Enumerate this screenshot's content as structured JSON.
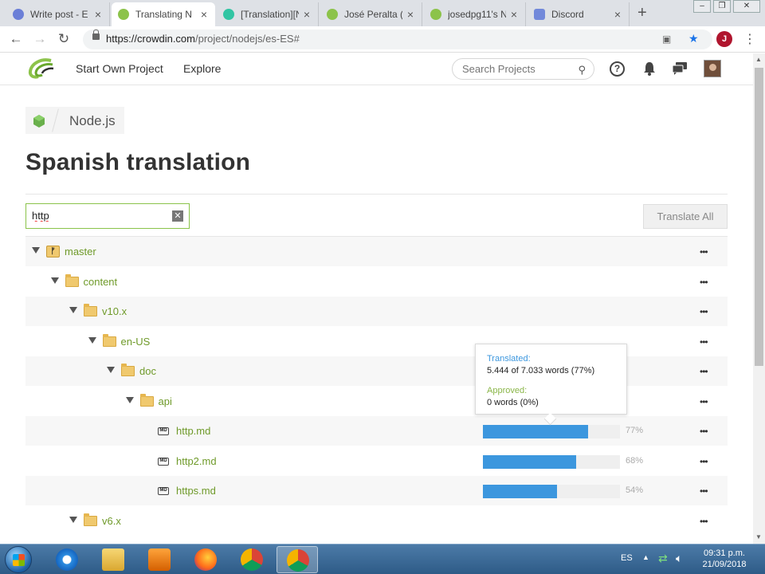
{
  "browser": {
    "tabs": [
      {
        "title": "Write post - E",
        "favicon_color": "#6b7fd7"
      },
      {
        "title": "Translating N",
        "favicon_color": "#8cc34a",
        "active": true
      },
      {
        "title": "[Translation][N",
        "favicon_color": "#31c5a3"
      },
      {
        "title": "José Peralta (",
        "favicon_color": "#8cc34a"
      },
      {
        "title": "josedpg11's N",
        "favicon_color": "#8cc34a"
      },
      {
        "title": "Discord",
        "favicon_color": "#7289da"
      }
    ],
    "url_host": "https://crowdin.com",
    "url_path": "/project/nodejs/es-ES#",
    "profile_initial": "J"
  },
  "header": {
    "links": [
      "Start Own Project",
      "Explore"
    ],
    "search_placeholder": "Search Projects"
  },
  "breadcrumb": {
    "project": "Node.js"
  },
  "page": {
    "title": "Spanish translation",
    "filter_value": "http",
    "translate_all_label": "Translate All"
  },
  "tree": [
    {
      "label": "master",
      "kind": "branch",
      "icon": "branch-icon"
    },
    {
      "label": "content",
      "kind": "folder",
      "icon": "folder-icon"
    },
    {
      "label": "v10.x",
      "kind": "folder",
      "icon": "folder-icon"
    },
    {
      "label": "en-US",
      "kind": "folder",
      "icon": "folder-icon"
    },
    {
      "label": "doc",
      "kind": "folder",
      "icon": "folder-icon"
    },
    {
      "label": "api",
      "kind": "folder",
      "icon": "folder-icon"
    },
    {
      "label": "http.md",
      "kind": "file",
      "icon": "markdown-icon",
      "progress": 77,
      "progress_label": "77%"
    },
    {
      "label": "http2.md",
      "kind": "file",
      "icon": "markdown-icon",
      "progress": 68,
      "progress_label": "68%"
    },
    {
      "label": "https.md",
      "kind": "file",
      "icon": "markdown-icon",
      "progress": 54,
      "progress_label": "54%"
    },
    {
      "label": "v6.x",
      "kind": "folder",
      "icon": "folder-icon"
    }
  ],
  "tooltip": {
    "translated_label": "Translated:",
    "translated_value": "5.444 of 7.033 words (77%)",
    "approved_label": "Approved:",
    "approved_value": "0 words (0%)"
  },
  "taskbar": {
    "language": "ES",
    "time": "09:31 p.m.",
    "date": "21/09/2018"
  },
  "colors": {
    "accent_green": "#8cc34a",
    "progress_blue": "#3c97de"
  }
}
